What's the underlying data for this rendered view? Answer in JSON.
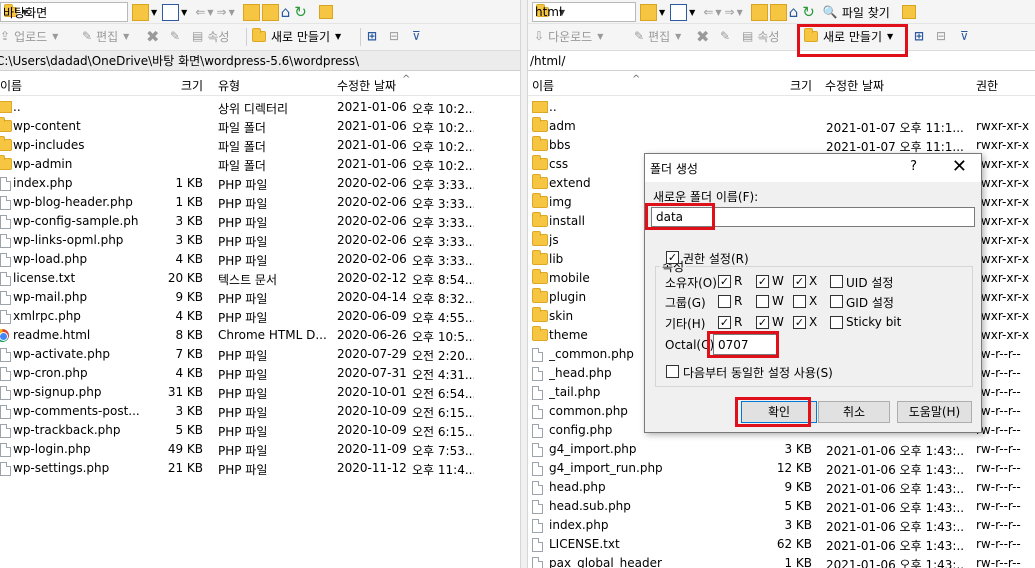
{
  "left": {
    "path_combo": "바탕화면",
    "toolbar2": {
      "upload": "업로드",
      "edit": "편집",
      "properties": "속성",
      "new_create": "새로 만들기"
    },
    "path": "C:\\Users\\dadad\\OneDrive\\바탕 화면\\wordpress-5.6\\wordpress\\",
    "columns": {
      "name": "이름",
      "size": "크기",
      "type": "유형",
      "modified": "수정한 날짜"
    },
    "files": [
      {
        "icon": "up-folder-icon",
        "name": "..",
        "size": "",
        "type": "상위 디렉터리",
        "date": "2021-01-06",
        "time": "오후 10:2..."
      },
      {
        "icon": "folder-icon",
        "name": "wp-content",
        "size": "",
        "type": "파일 폴더",
        "date": "2021-01-06",
        "time": "오후 10:2..."
      },
      {
        "icon": "folder-icon",
        "name": "wp-includes",
        "size": "",
        "type": "파일 폴더",
        "date": "2021-01-06",
        "time": "오후 10:2..."
      },
      {
        "icon": "folder-icon",
        "name": "wp-admin",
        "size": "",
        "type": "파일 폴더",
        "date": "2021-01-06",
        "time": "오후 10:2..."
      },
      {
        "icon": "file-icon",
        "name": "index.php",
        "size": "1 KB",
        "type": "PHP 파일",
        "date": "2020-02-06",
        "time": "오후 3:33..."
      },
      {
        "icon": "file-icon",
        "name": "wp-blog-header.php",
        "size": "1 KB",
        "type": "PHP 파일",
        "date": "2020-02-06",
        "time": "오후 3:33..."
      },
      {
        "icon": "file-icon",
        "name": "wp-config-sample.php",
        "size": "3 KB",
        "type": "PHP 파일",
        "date": "2020-02-06",
        "time": "오후 3:33..."
      },
      {
        "icon": "file-icon",
        "name": "wp-links-opml.php",
        "size": "3 KB",
        "type": "PHP 파일",
        "date": "2020-02-06",
        "time": "오후 3:33..."
      },
      {
        "icon": "file-icon",
        "name": "wp-load.php",
        "size": "4 KB",
        "type": "PHP 파일",
        "date": "2020-02-06",
        "time": "오후 3:33..."
      },
      {
        "icon": "file-icon",
        "name": "license.txt",
        "size": "20 KB",
        "type": "텍스트 문서",
        "date": "2020-02-12",
        "time": "오후 8:54..."
      },
      {
        "icon": "file-icon",
        "name": "wp-mail.php",
        "size": "9 KB",
        "type": "PHP 파일",
        "date": "2020-04-14",
        "time": "오후 8:32..."
      },
      {
        "icon": "file-icon",
        "name": "xmlrpc.php",
        "size": "4 KB",
        "type": "PHP 파일",
        "date": "2020-06-09",
        "time": "오후 4:55..."
      },
      {
        "icon": "chrome-icon",
        "name": "readme.html",
        "size": "8 KB",
        "type": "Chrome HTML D...",
        "date": "2020-06-26",
        "time": "오후 10:5..."
      },
      {
        "icon": "file-icon",
        "name": "wp-activate.php",
        "size": "7 KB",
        "type": "PHP 파일",
        "date": "2020-07-29",
        "time": "오전 2:20..."
      },
      {
        "icon": "file-icon",
        "name": "wp-cron.php",
        "size": "4 KB",
        "type": "PHP 파일",
        "date": "2020-07-31",
        "time": "오전 4:31..."
      },
      {
        "icon": "file-icon",
        "name": "wp-signup.php",
        "size": "31 KB",
        "type": "PHP 파일",
        "date": "2020-10-01",
        "time": "오전 6:54..."
      },
      {
        "icon": "file-icon",
        "name": "wp-comments-post....",
        "size": "3 KB",
        "type": "PHP 파일",
        "date": "2020-10-09",
        "time": "오전 6:15..."
      },
      {
        "icon": "file-icon",
        "name": "wp-trackback.php",
        "size": "5 KB",
        "type": "PHP 파일",
        "date": "2020-10-09",
        "time": "오전 6:15..."
      },
      {
        "icon": "file-icon",
        "name": "wp-login.php",
        "size": "49 KB",
        "type": "PHP 파일",
        "date": "2020-11-09",
        "time": "오후 7:53..."
      },
      {
        "icon": "file-icon",
        "name": "wp-settings.php",
        "size": "21 KB",
        "type": "PHP 파일",
        "date": "2020-11-12",
        "time": "오후 11:4..."
      }
    ]
  },
  "right": {
    "path_combo": "html",
    "find_files": "파일 찾기",
    "toolbar2": {
      "download": "다운로드",
      "edit": "편집",
      "properties": "속성",
      "new_create": "새로 만들기"
    },
    "path": "/html/",
    "columns": {
      "name": "이름",
      "size": "크기",
      "modified": "수정한 날짜",
      "perm": "권한"
    },
    "files": [
      {
        "icon": "up-folder-icon",
        "name": "..",
        "size": "",
        "date": "",
        "perm": ""
      },
      {
        "icon": "folder-icon",
        "name": "adm",
        "size": "",
        "date": "2021-01-07 오후 11:1...",
        "perm": "rwxr-xr-x"
      },
      {
        "icon": "folder-icon",
        "name": "bbs",
        "size": "",
        "date": "2021-01-07 오후 11:1...",
        "perm": "rwxr-xr-x"
      },
      {
        "icon": "folder-icon",
        "name": "css",
        "size": "",
        "date": "",
        "perm": "rwxr-xr-x"
      },
      {
        "icon": "folder-icon",
        "name": "extend",
        "size": "",
        "date": "",
        "perm": "rwxr-xr-x"
      },
      {
        "icon": "folder-icon",
        "name": "img",
        "size": "",
        "date": "",
        "perm": "rwxr-xr-x"
      },
      {
        "icon": "folder-icon",
        "name": "install",
        "size": "",
        "date": "",
        "perm": "rwxr-xr-x"
      },
      {
        "icon": "folder-icon",
        "name": "js",
        "size": "",
        "date": "",
        "perm": "rwxr-xr-x"
      },
      {
        "icon": "folder-icon",
        "name": "lib",
        "size": "",
        "date": "",
        "perm": "rwxr-xr-x"
      },
      {
        "icon": "folder-icon",
        "name": "mobile",
        "size": "",
        "date": "",
        "perm": "rwxr-xr-x"
      },
      {
        "icon": "folder-icon",
        "name": "plugin",
        "size": "",
        "date": "",
        "perm": "rwxr-xr-x"
      },
      {
        "icon": "folder-icon",
        "name": "skin",
        "size": "",
        "date": "",
        "perm": "rwxr-xr-x"
      },
      {
        "icon": "folder-icon",
        "name": "theme",
        "size": "",
        "date": "",
        "perm": "rwxr-xr-x"
      },
      {
        "icon": "file-icon",
        "name": "_common.php",
        "size": "",
        "date": "",
        "perm": "rw-r--r--"
      },
      {
        "icon": "file-icon",
        "name": "_head.php",
        "size": "",
        "date": "",
        "perm": "rw-r--r--"
      },
      {
        "icon": "file-icon",
        "name": "_tail.php",
        "size": "",
        "date": "",
        "perm": "rw-r--r--"
      },
      {
        "icon": "file-icon",
        "name": "common.php",
        "size": "",
        "date": "",
        "perm": "rw-r--r--"
      },
      {
        "icon": "file-icon",
        "name": "config.php",
        "size": "",
        "date": "",
        "perm": "rw-r--r--"
      },
      {
        "icon": "file-icon",
        "name": "g4_import.php",
        "size": "3 KB",
        "date": "2021-01-06 오후 1:43:...",
        "perm": "rw-r--r--"
      },
      {
        "icon": "file-icon",
        "name": "g4_import_run.php",
        "size": "12 KB",
        "date": "2021-01-06 오후 1:43:...",
        "perm": "rw-r--r--"
      },
      {
        "icon": "file-icon",
        "name": "head.php",
        "size": "9 KB",
        "date": "2021-01-06 오후 1:43:...",
        "perm": "rw-r--r--"
      },
      {
        "icon": "file-icon",
        "name": "head.sub.php",
        "size": "5 KB",
        "date": "2021-01-06 오후 1:43:...",
        "perm": "rw-r--r--"
      },
      {
        "icon": "file-icon",
        "name": "index.php",
        "size": "3 KB",
        "date": "2021-01-06 오후 1:43:...",
        "perm": "rw-r--r--"
      },
      {
        "icon": "file-icon",
        "name": "LICENSE.txt",
        "size": "62 KB",
        "date": "2021-01-06 오후 1:43:...",
        "perm": "rw-r--r--"
      },
      {
        "icon": "file-icon",
        "name": "pax_global_header",
        "size": "1 KB",
        "date": "2021-01-06 오후 1:43:...",
        "perm": "rw-r--r--"
      }
    ]
  },
  "dialog": {
    "title": "폴더 생성",
    "help": "?",
    "close": "✕",
    "new_folder_label": "새로운 폴더 이름(F):",
    "new_folder_value": "data",
    "attributes_label": "속성",
    "set_perm_label": "권한 설정(R)",
    "set_perm_checked": true,
    "owner_label": "소유자(O)",
    "group_label": "그룹(G)",
    "other_label": "기타(H)",
    "r": "R",
    "w": "W",
    "x": "X",
    "uid_label": "UID 설정",
    "gid_label": "GID 설정",
    "sticky_label": "Sticky bit",
    "perm_checks": {
      "owner": [
        true,
        true,
        true
      ],
      "group": [
        false,
        false,
        false
      ],
      "other": [
        true,
        true,
        true
      ]
    },
    "octal_label": "Octal(C):",
    "octal_value": "0707",
    "reuse_label": "다음부터 동일한 설정 사용(S)",
    "ok": "확인",
    "cancel": "취소",
    "help_btn": "도움말(H)"
  },
  "colors": {
    "highlight": "#e0101b",
    "folder": "#f6c541",
    "focus_border": "#0078d7"
  }
}
